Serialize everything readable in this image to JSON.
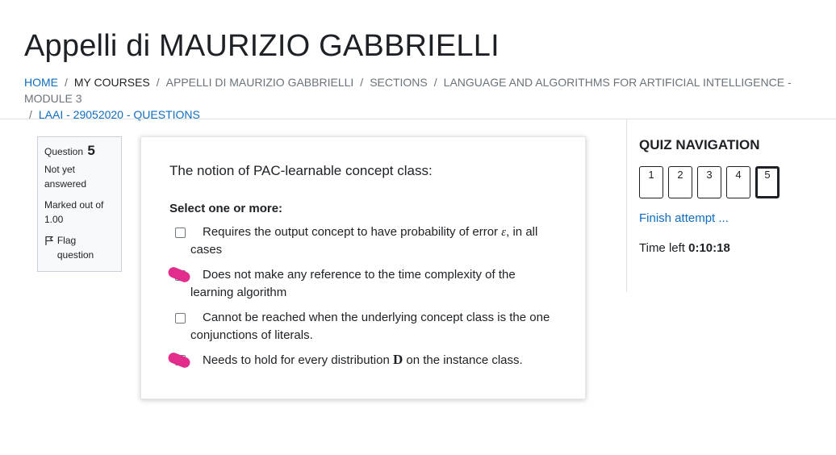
{
  "page": {
    "title": "Appelli di MAURIZIO GABBRIELLI"
  },
  "breadcrumb": {
    "items": [
      {
        "label": "HOME"
      },
      {
        "label": "MY COURSES"
      },
      {
        "label": "APPELLI DI MAURIZIO GABBRIELLI"
      },
      {
        "label": "SECTIONS"
      },
      {
        "label": "LANGUAGE AND ALGORITHMS FOR ARTIFICIAL INTELLIGENCE - MODULE 3"
      },
      {
        "label": "LAAI - 29052020 - QUESTIONS"
      }
    ],
    "separator": "/"
  },
  "question_info": {
    "label": "Question",
    "number": "5",
    "state": "Not yet answered",
    "grade": "Marked out of 1.00",
    "flag_label": "Flag question",
    "flag_icon": "flag-icon"
  },
  "question": {
    "text": "The notion of PAC-learnable concept class:",
    "prompt": "Select one or more:",
    "answers": [
      {
        "pre": "Requires the output concept to have probability of error ",
        "symbol": "ε",
        "post": ", in all cases",
        "checked": false,
        "highlight": false
      },
      {
        "text": "Does not make any reference to the time complexity of the learning algorithm",
        "checked": false,
        "highlight": true
      },
      {
        "text": "Cannot be reached when the underlying concept class is the one conjunctions of literals.",
        "checked": false,
        "highlight": false
      },
      {
        "pre": "Needs to hold for every distribution ",
        "symbol": "D",
        "post": " on the instance class.",
        "checked": false,
        "highlight": true
      }
    ],
    "highlight_color": "#e22d8c"
  },
  "quiz_navigation": {
    "title": "QUIZ NAVIGATION",
    "buttons": [
      "1",
      "2",
      "3",
      "4",
      "5"
    ],
    "current": "5",
    "finish_label": "Finish attempt ...",
    "time_label": "Time left",
    "time_value": "0:10:18"
  },
  "colors": {
    "link": "#0f6cbf",
    "text": "#1d2125",
    "muted": "#6a737b"
  }
}
